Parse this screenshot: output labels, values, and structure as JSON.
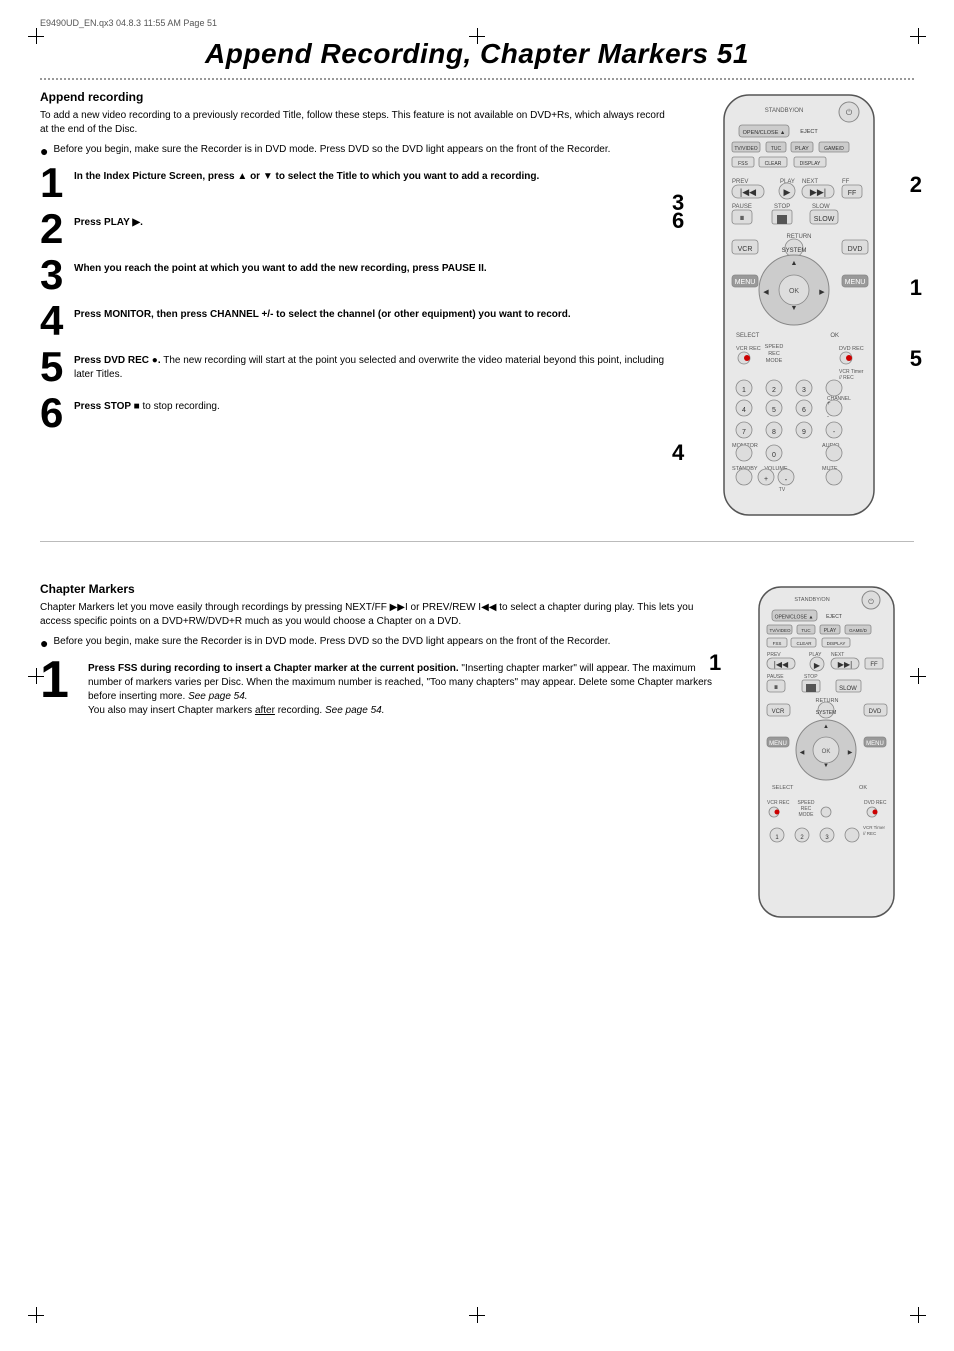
{
  "header": {
    "file_info": "E9490UD_EN.qx3  04.8.3  11:55 AM  Page 51"
  },
  "page_title": "Append Recording, Chapter Markers  51",
  "section1": {
    "heading": "Append recording",
    "intro": "To add a new video recording to a previously recorded Title, follow these steps. This feature is not available on DVD+Rs, which always record at the end of the Disc.",
    "bullet": "Before you begin, make sure the Recorder is in DVD mode. Press DVD so the DVD light appears on the front of the Recorder.",
    "steps": [
      {
        "number": "1",
        "text": "In the Index Picture Screen, press ▲ or ▼ to select the Title to which you want to add a recording."
      },
      {
        "number": "2",
        "text": "Press PLAY ▶."
      },
      {
        "number": "3",
        "text": "When you reach the point at which you want to add the new recording, press PAUSE II."
      },
      {
        "number": "4",
        "text": "Press MONITOR, then press CHANNEL +/- to select the channel (or other equipment) you want to record."
      },
      {
        "number": "5",
        "text": "Press DVD REC ●. The new recording will start at the point you selected and overwrite the video material beyond this point, including later Titles."
      },
      {
        "number": "6",
        "text": "Press STOP ■ to stop recording."
      }
    ]
  },
  "section2": {
    "heading": "Chapter Markers",
    "intro": "Chapter Markers let you move easily through recordings by pressing NEXT/FF ▶▶I or PREV/REW I◀◀ to select a chapter during play. This lets you access specific points on a DVD+RW/DVD+R much as you would choose a Chapter on a DVD.",
    "bullet": "Before you begin, make sure the Recorder is in DVD mode. Press DVD so the DVD light appears on the front of the Recorder.",
    "steps": [
      {
        "number": "1",
        "text_bold": "Press FSS during recording to insert a Chapter marker at the current position.",
        "text_normal": " \"Inserting chapter marker\" will appear. The maximum number of markers varies per Disc. When the maximum number is reached, \"Too many chapters\" may appear. Delete some Chapter markers before inserting more. See page 54.\nYou also may insert Chapter markers after recording. See page 54."
      }
    ]
  }
}
